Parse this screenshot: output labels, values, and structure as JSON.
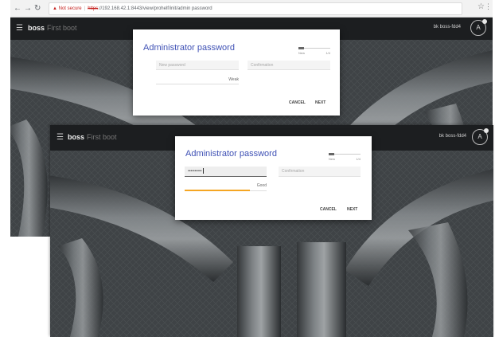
{
  "browser": {
    "security_warning": "Not secure",
    "url_scheme": "https",
    "url_rest": "://192.168.42.1:8443/view/prohelf/init/admin password"
  },
  "app": {
    "brand": "boss",
    "brand_sub": "First boot",
    "host_back": "bk boss-fdd4",
    "host_front": "bk boss-fdd4",
    "avatar_initial": "A"
  },
  "dialog_back": {
    "title": "Administrator password",
    "stepper_left": "New",
    "stepper_right": "1/4",
    "new_password_placeholder": "New password",
    "confirmation_placeholder": "Confirmation",
    "strength_label": "Weak",
    "cancel_label": "CANCEL",
    "next_label": "NEXT"
  },
  "dialog_front": {
    "title": "Administrator password",
    "stepper_left": "New",
    "stepper_right": "1/4",
    "new_password_value": "••••••••••",
    "confirmation_placeholder": "Confirmation",
    "strength_label": "Good",
    "strength_fraction": 0.8,
    "cancel_label": "CANCEL",
    "next_label": "NEXT"
  },
  "colors": {
    "title": "#3f51b5",
    "strength_good": "#f5a623",
    "appbar": "#191b1d",
    "background": "#3d4144"
  },
  "icons": [
    "back-arrow-icon",
    "forward-arrow-icon",
    "reload-icon",
    "warning-icon",
    "star-icon",
    "menu-icon",
    "hamburger-icon",
    "avatar-icon"
  ]
}
